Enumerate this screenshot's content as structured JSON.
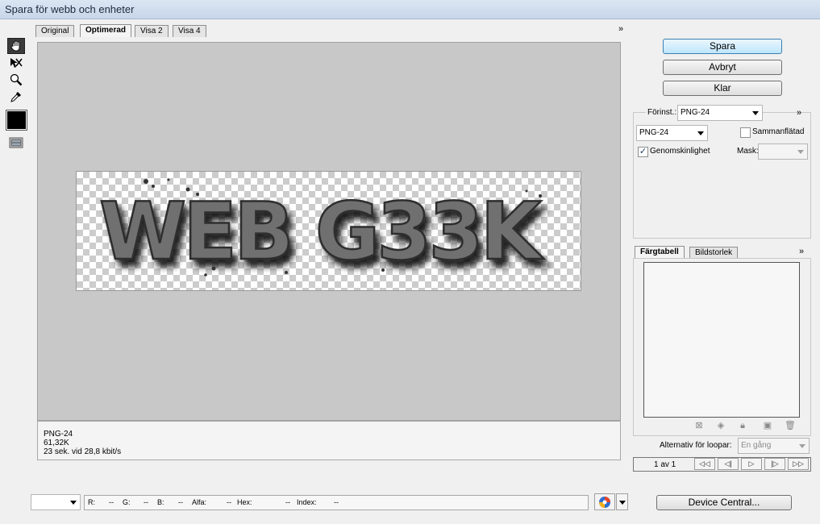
{
  "window": {
    "title": "Spara för webb och enheter"
  },
  "tabs": [
    {
      "label": "Original"
    },
    {
      "label": "Optimerad"
    },
    {
      "label": "Visa 2"
    },
    {
      "label": "Visa 4"
    }
  ],
  "tools": [
    "hand-icon",
    "slice-select-icon",
    "zoom-icon",
    "eyedropper-icon",
    "eyedropper-color-swatch",
    "toggle-slices-icon"
  ],
  "colors": {
    "eyedropper_color": "#000000",
    "canvas_bg": "#c8c8c8",
    "primary_button": "#bee6fd"
  },
  "image": {
    "text": "WEB G33K"
  },
  "info": {
    "format": "PNG-24",
    "size": "61,32K",
    "time": "23 sek. vid 28,8 kbit/s"
  },
  "buttons": {
    "save": "Spara",
    "cancel": "Avbryt",
    "done": "Klar",
    "device_central": "Device Central..."
  },
  "settings": {
    "preset_label": "Förinst.:",
    "preset_value": "PNG-24",
    "format_value": "PNG-24",
    "interlaced_label": "Sammanflätad",
    "interlaced_checked": false,
    "transparency_label": "Genomskinlighet",
    "transparency_checked": true,
    "matte_label": "Mask:",
    "matte_value": ""
  },
  "panel_tabs": [
    {
      "label": "Färgtabell"
    },
    {
      "label": "Bildstorlek"
    }
  ],
  "loop": {
    "label": "Alternativ för loopar:",
    "value": "En gång"
  },
  "animation": {
    "frame_counter": "1 av 1",
    "nav": [
      "◁◁",
      "◁|",
      "▷",
      "|▷",
      "▷▷"
    ]
  },
  "status": {
    "zoom_value": "",
    "r_label": "R:",
    "r_value": "--",
    "g_label": "G:",
    "g_value": "--",
    "b_label": "B:",
    "b_value": "--",
    "alpha_label": "Alfa:",
    "alpha_value": "--",
    "hex_label": "Hex:",
    "hex_value": "--",
    "index_label": "Index:",
    "index_value": "--"
  },
  "icons": {
    "panel_menu": "»"
  }
}
